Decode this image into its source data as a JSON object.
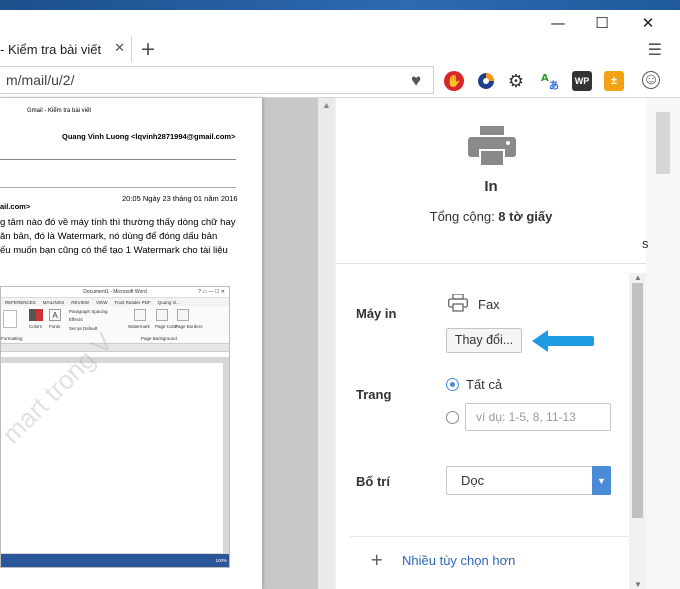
{
  "window": {
    "minimize": "—",
    "maximize": "☐",
    "close": "✕"
  },
  "tab": {
    "title": "- Kiểm tra bài viết",
    "close": "✕",
    "new_tab": "+"
  },
  "menu": {
    "icon": "hamburger-icon"
  },
  "address": {
    "url": "m/mail/u/2/"
  },
  "extensions": [
    "heart-icon",
    "adblock-icon",
    "firefox-sync-icon",
    "gear-icon",
    "translate-icon",
    "wp-icon",
    "calculator-icon",
    "account-icon"
  ],
  "preview": {
    "header_small": "Gmail - Kiểm tra bài viết",
    "sender": "Quang Vinh Luong <lqvinh2871994@gmail.com>",
    "recipient_fragment": "ail.com>",
    "date": "20:05 Ngày 23 tháng 01 năm 2016",
    "body_lines": [
      "g tâm nào đó về máy tính thì thường thấy dòng chữ hay",
      "ăn bản, đó là Watermark, nó dùng để đóng dấu bản",
      "ếu muốn bạn cũng có thể tạo 1 Watermark cho tài liệu"
    ],
    "watermark": "mart trong V",
    "word": {
      "title": "Document1 - Microsoft Word",
      "tabs": [
        "REFERENCES",
        "MAILINGS",
        "REVIEW",
        "VIEW",
        "Foxit Reader PDF",
        "Quang Vi..."
      ],
      "ribbon_labels": [
        "Colors",
        "Fonts",
        "Paragraph Spacing",
        "Effects",
        "Set as Default",
        "Watermark",
        "Page Color",
        "Page Borders",
        "Page Background",
        "Formatting"
      ],
      "zoom": "100%"
    }
  },
  "dialog": {
    "title": "In",
    "total_label": "Tổng cộng: ",
    "total_value": "8 tờ giấy",
    "printer_label": "Máy in",
    "printer_name": "Fax",
    "change_button": "Thay đổi...",
    "pages_label": "Trang",
    "pages_all": "Tất cả",
    "pages_placeholder": "ví dụ: 1-5, 8, 11-13",
    "layout_label": "Bố trí",
    "layout_value": "Dọc",
    "more_options": "Nhiều tùy chọn hơn"
  },
  "right_fragment": "s",
  "colors": {
    "accent": "#4a8ad6",
    "arrow": "#1e9be0",
    "link": "#2a68b8"
  }
}
